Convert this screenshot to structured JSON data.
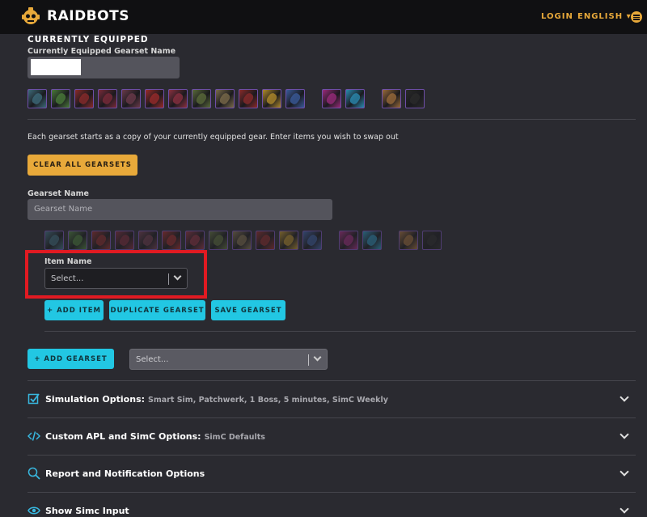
{
  "header": {
    "brand": "RAIDBOTS",
    "login": "LOGIN",
    "language": "ENGLISH",
    "language_caret": "▾"
  },
  "equipped": {
    "section_title": "CURRENTLY EQUIPPED",
    "name_label": "Currently Equipped Gearset Name",
    "gear_colors": [
      "#3d6a7a",
      "#4a7a3a",
      "#8a2a2a",
      "#7a2a3a",
      "#6a3a4a",
      "#9a2a2a",
      "#8a3040",
      "#5a6a3a",
      "#7a6a4a",
      "#8a2a2a",
      "#b08a2a",
      "#3a5a9a",
      "#9a2a7a",
      "#2a8ab0",
      "#9a6a3a",
      "#2a2a2a"
    ]
  },
  "gearset": {
    "description": "Each gearset starts as a copy of your currently equipped gear. Enter items you wish to swap out",
    "clear_button": "CLEAR ALL GEARSETS",
    "name_label": "Gearset Name",
    "name_placeholder": "Gearset Name",
    "item_label": "Item Name",
    "item_placeholder": "Select...",
    "add_item": "+ ADD ITEM",
    "duplicate": "DUPLICATE GEARSET",
    "save": "SAVE GEARSET"
  },
  "add_gearset": {
    "button": "+ ADD GEARSET",
    "select_placeholder": "Select..."
  },
  "accordions": [
    {
      "title": "Simulation Options:",
      "subtitle": "Smart Sim, Patchwerk, 1 Boss, 5 minutes, SimC Weekly",
      "icon": "checkbox-icon"
    },
    {
      "title": "Custom APL and SimC Options:",
      "subtitle": "SimC Defaults",
      "icon": "code-icon"
    },
    {
      "title": "Report and Notification Options",
      "subtitle": "",
      "icon": "search-icon"
    },
    {
      "title": "Show Simc Input",
      "subtitle": "",
      "icon": "eye-icon"
    }
  ],
  "colors": {
    "accent_orange": "#e8a93a",
    "accent_cyan": "#22c7e3",
    "highlight_red": "#e11a22",
    "background": "#2a2a30"
  }
}
